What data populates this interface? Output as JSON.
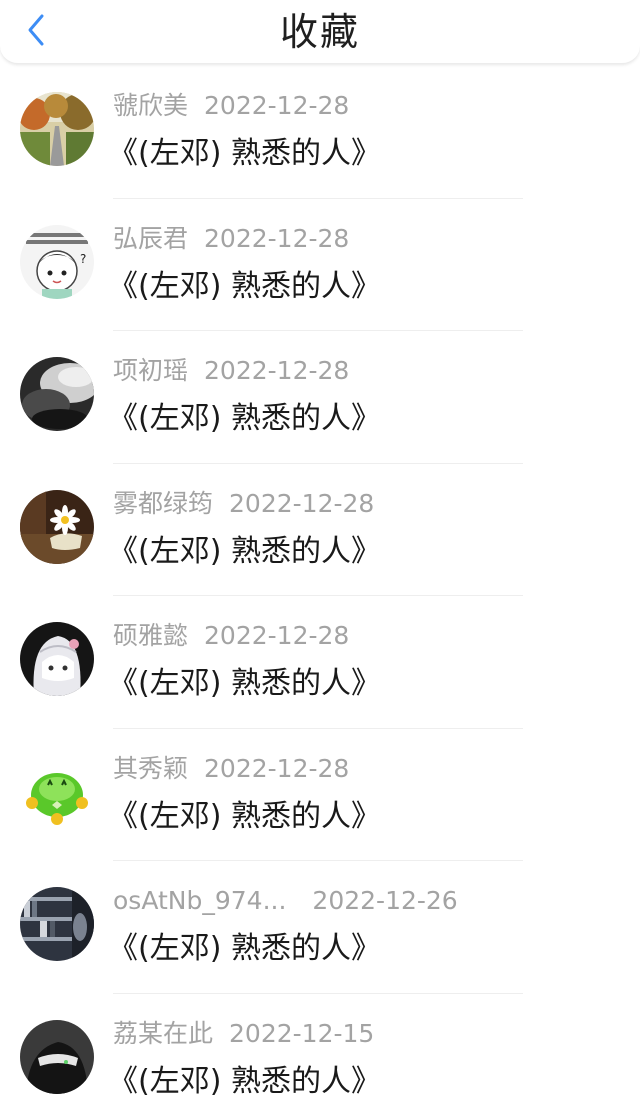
{
  "header": {
    "title": "收藏",
    "back_icon": "chevron-left-icon",
    "accent": "#3d8df5"
  },
  "items": [
    {
      "name": "虢欣美",
      "date": "2022-12-28",
      "work": "《(左邓) 熟悉的人》",
      "avatar": "tree-road-avatar"
    },
    {
      "name": "弘辰君",
      "date": "2022-12-28",
      "work": "《(左邓) 熟悉的人》",
      "avatar": "cartoon-girl-avatar"
    },
    {
      "name": "项初瑶",
      "date": "2022-12-28",
      "work": "《(左邓) 熟悉的人》",
      "avatar": "dark-cloud-avatar"
    },
    {
      "name": "雾都绿筠",
      "date": "2022-12-28",
      "work": "《(左邓) 熟悉的人》",
      "avatar": "daisy-avatar"
    },
    {
      "name": "硕雅懿",
      "date": "2022-12-28",
      "work": "《(左邓) 熟悉的人》",
      "avatar": "anime-girl-avatar"
    },
    {
      "name": "其秀颖",
      "date": "2022-12-28",
      "work": "《(左邓) 熟悉的人》",
      "avatar": "green-frog-avatar"
    },
    {
      "name": "osAtNb_974...",
      "date": "2022-12-26",
      "work": "《(左邓) 熟悉的人》",
      "avatar": "bookshelf-avatar"
    },
    {
      "name": "荔某在此",
      "date": "2022-12-15",
      "work": "《(左邓) 熟悉的人》",
      "avatar": "masked-person-avatar"
    }
  ]
}
